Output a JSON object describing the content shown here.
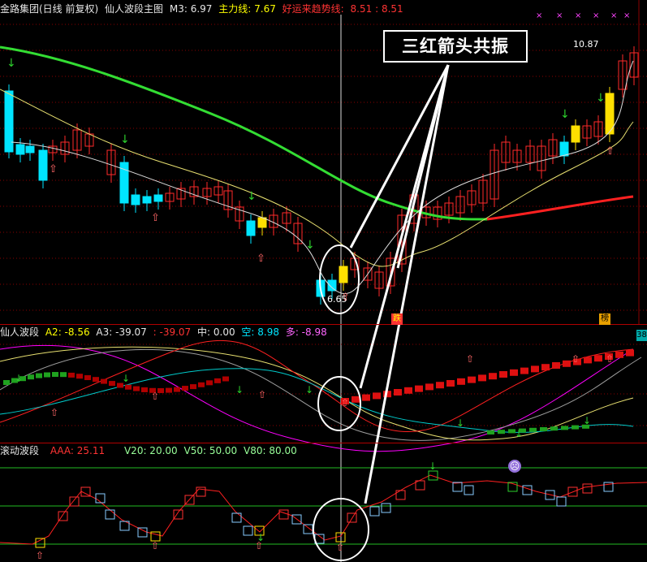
{
  "main_header": {
    "stock": "金路集团(日线 前复权)",
    "indicator": "仙人波段主图",
    "m3": "M3: 6.97",
    "main_line": "主力线: 7.67",
    "trend_label": "好运来趋势线:",
    "trend_values": "8.51 : 8.51"
  },
  "osc_header": {
    "title": "仙人波段",
    "a2": "A2: -8.56",
    "a3": "A3: -39.07",
    "a3b": ": -39.07",
    "mid": "中: 0.00",
    "empty": "空: 8.98",
    "many": "多: -8.98"
  },
  "roll_header": {
    "title": "滚动波段",
    "aaa": "AAA: 25.11",
    "v20": "V20: 20.00",
    "v50": "V50: 50.00",
    "v80": "V80: 80.00"
  },
  "callout": "三红箭头共振",
  "price_high": "10.87",
  "price_low": "6.65",
  "scale_tag": "38",
  "badge_1": "跌",
  "badge_2": "榜",
  "face_icon": "face-icon",
  "colors": {
    "up": "#ff2a2a",
    "down": "#00e5ff",
    "yellow": "#ffe000",
    "green_ma": "#33dd33",
    "ma_yellow": "#e8e070",
    "ma_red": "#ff2020",
    "grid": "#8a0000"
  }
}
